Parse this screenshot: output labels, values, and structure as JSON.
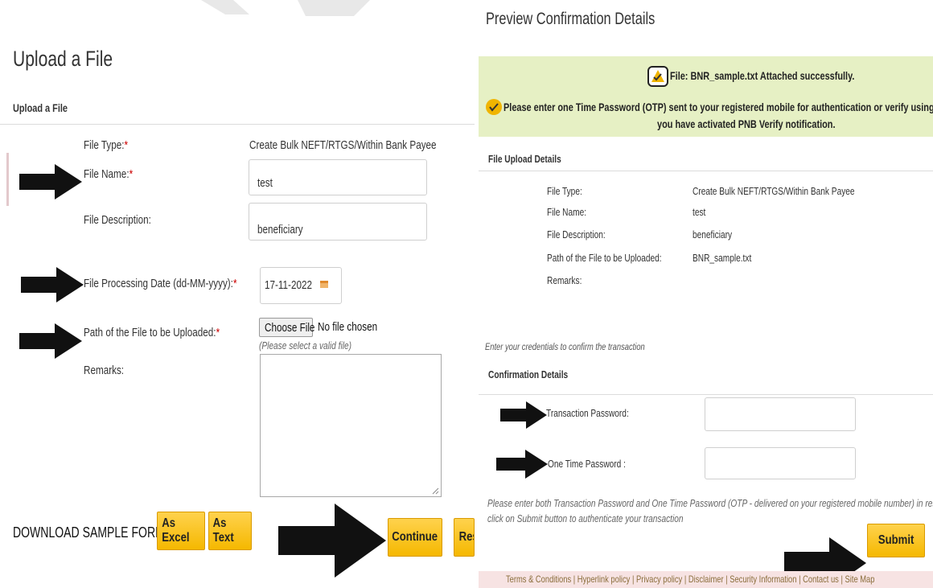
{
  "left": {
    "title": "Upload a File",
    "section_header": "Upload a File",
    "file_type_label": "File Type:",
    "file_type_value": "Create Bulk NEFT/RTGS/Within Bank Payee",
    "file_name_label": "File Name:",
    "file_name_value": "test",
    "file_desc_label": "File Description:",
    "file_desc_value": "beneficiary",
    "proc_date_label": "File Processing Date (dd-MM-yyyy):",
    "proc_date_value": "17-11-2022",
    "path_label": "Path of the File to be Uploaded:",
    "choose_file_label": "Choose File",
    "no_file_text": "No file chosen",
    "valid_file_hint": "(Please select a valid file)",
    "remarks_label": "Remarks:",
    "required_mark": "*",
    "download_label": "DOWNLOAD SAMPLE FORMATS:",
    "as_excel": "As Excel",
    "as_text": "As Text",
    "continue": "Continue",
    "reset_partial": "Res"
  },
  "right": {
    "title": "Preview Confirmation Details",
    "success_msg": "File: BNR_sample.txt Attached successfully.",
    "otp_msg_line1": "Please enter one Time Password (OTP) sent to your registered mobile for authentication or verify using PNB verify mobil",
    "otp_msg_line2": "you have activated PNB Verify notification.",
    "upload_details_header": "File Upload Details",
    "details": [
      {
        "label": "File Type:",
        "value": "Create Bulk NEFT/RTGS/Within Bank Payee"
      },
      {
        "label": "File Name:",
        "value": "test"
      },
      {
        "label": "File Description:",
        "value": "beneficiary"
      },
      {
        "label": "Path of the File to be Uploaded:",
        "value": "BNR_sample.txt"
      },
      {
        "label": "Remarks:",
        "value": ""
      }
    ],
    "credentials_hint": "Enter your credentials to confirm the transaction",
    "confirmation_header": "Confirmation Details",
    "txn_password_label": "Transaction Password:",
    "otp_label": "One Time Password :",
    "instructions_line1": "Please enter both Transaction Password and One Time Password (OTP - delivered on your registered mobile number) in respective field",
    "instructions_line2": "click on Submit button to authenticate your transaction",
    "submit": "Submit",
    "footer_links": [
      "Terms & Conditions",
      "Hyperlink policy",
      "Privacy policy",
      "Disclaimer",
      "Security Information",
      "Contact us",
      "Site Map"
    ],
    "footer_separator": "|"
  },
  "colors": {
    "accent_yellow": "#f5b800",
    "notice_bg": "#e6f0c4",
    "footer_bg": "#f7e3e3",
    "required": "#cc0000"
  }
}
